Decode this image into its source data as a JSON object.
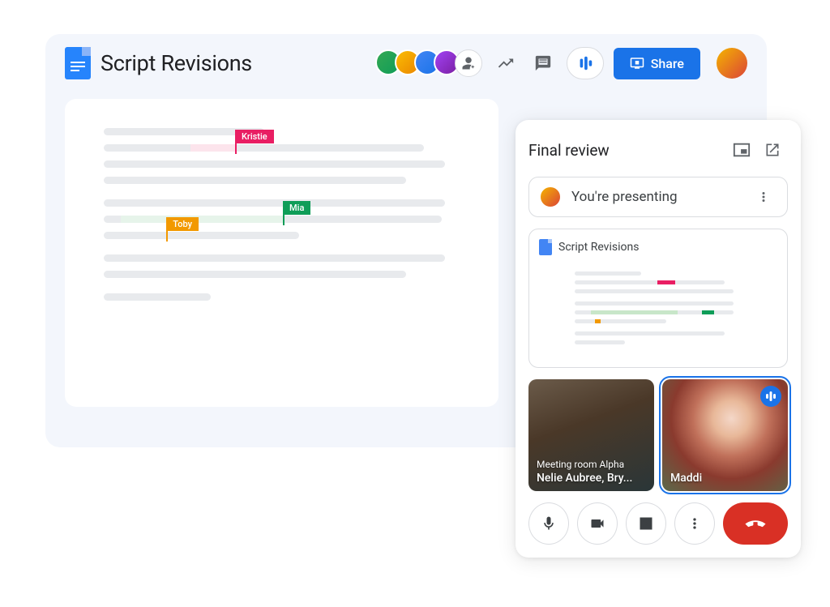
{
  "doc": {
    "title": "Script Revisions",
    "collaborators": [
      "collab-1",
      "collab-2",
      "collab-3",
      "collab-4"
    ],
    "share_label": "Share",
    "cursors": {
      "kristie": {
        "name": "Kristie",
        "color": "#e91e63"
      },
      "mia": {
        "name": "Mia",
        "color": "#0f9d58"
      },
      "toby": {
        "name": "Toby",
        "color": "#f29900"
      }
    }
  },
  "meet": {
    "title": "Final review",
    "presenting_text": "You're presenting",
    "presented_doc_title": "Script Revisions",
    "tiles": [
      {
        "room": "Meeting room Alpha",
        "names": "Nelie Aubree, Bry..."
      },
      {
        "name": "Maddi",
        "speaking": true
      }
    ]
  },
  "icons": {
    "anonymous": "anonymous-user-icon",
    "trending": "trending-up-icon",
    "comments": "comments-icon",
    "meet_join": "meet-audio-icon",
    "present": "present-icon",
    "pip": "picture-in-picture-icon",
    "popout": "open-new-icon",
    "more": "more-vert-icon",
    "mic": "mic-icon",
    "camera": "camera-icon",
    "stop_present": "stop-present-icon",
    "hangup": "hangup-icon"
  },
  "colors": {
    "accent": "#1a73e8",
    "danger": "#d93025",
    "pink": "#e91e63",
    "green": "#0f9d58",
    "orange": "#f29900"
  }
}
